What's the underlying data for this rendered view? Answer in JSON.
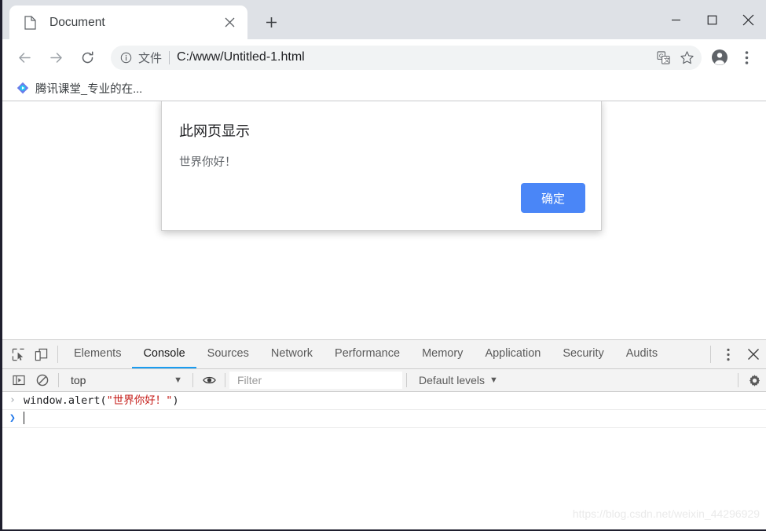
{
  "browser": {
    "tab": {
      "title": "Document",
      "favicon": "page-icon",
      "close_icon": "close-icon"
    },
    "new_tab_label": "+",
    "window_controls": {
      "minimize": "minimize-icon",
      "maximize": "maximize-icon",
      "close": "close-icon"
    },
    "toolbar": {
      "back": "back-arrow-icon",
      "forward": "forward-arrow-icon",
      "reload": "reload-icon",
      "info_icon": "info-circle-icon",
      "scheme_label": "文件",
      "url": "C:/www/Untitled-1.html",
      "translate_icon": "translate-icon",
      "bookmark_star_icon": "star-icon",
      "profile_icon": "profile-avatar-icon",
      "menu_icon": "three-dot-menu-icon"
    },
    "bookmarks": [
      {
        "label": "腾讯课堂_专业的在...",
        "icon": "tencent-classroom-icon"
      }
    ]
  },
  "dialog": {
    "title": "此网页显示",
    "message": "世界你好！",
    "ok_label": "确定",
    "accent_color": "#4a86f7"
  },
  "devtools": {
    "left_icons": [
      {
        "name": "inspect-element-icon"
      },
      {
        "name": "device-toolbar-icon"
      }
    ],
    "tabs": [
      {
        "label": "Elements",
        "active": false
      },
      {
        "label": "Console",
        "active": true
      },
      {
        "label": "Sources",
        "active": false
      },
      {
        "label": "Network",
        "active": false
      },
      {
        "label": "Performance",
        "active": false
      },
      {
        "label": "Memory",
        "active": false
      },
      {
        "label": "Application",
        "active": false
      },
      {
        "label": "Security",
        "active": false
      },
      {
        "label": "Audits",
        "active": false
      }
    ],
    "active_tab_underline_color": "#1a9cf0",
    "right_icons": [
      {
        "name": "more-options-icon"
      },
      {
        "name": "close-devtools-icon"
      }
    ],
    "console_toolbar": {
      "sidebar_icon": "console-sidebar-icon",
      "clear_icon": "clear-console-icon",
      "context": "top",
      "context_caret": "▼",
      "eye_icon": "live-expression-eye-icon",
      "filter_placeholder": "Filter",
      "filter_value": "",
      "levels_label": "Default levels",
      "levels_caret": "▼",
      "settings_icon": "gear-icon"
    },
    "console_rows": [
      {
        "arrow": "›",
        "code_prefix": "window.alert(",
        "code_string": "\"世界你好！\"",
        "code_suffix": ")"
      }
    ],
    "prompt": {
      "arrow": "❯",
      "value": ""
    }
  },
  "watermark": "https://blog.csdn.net/weixin_44296929"
}
